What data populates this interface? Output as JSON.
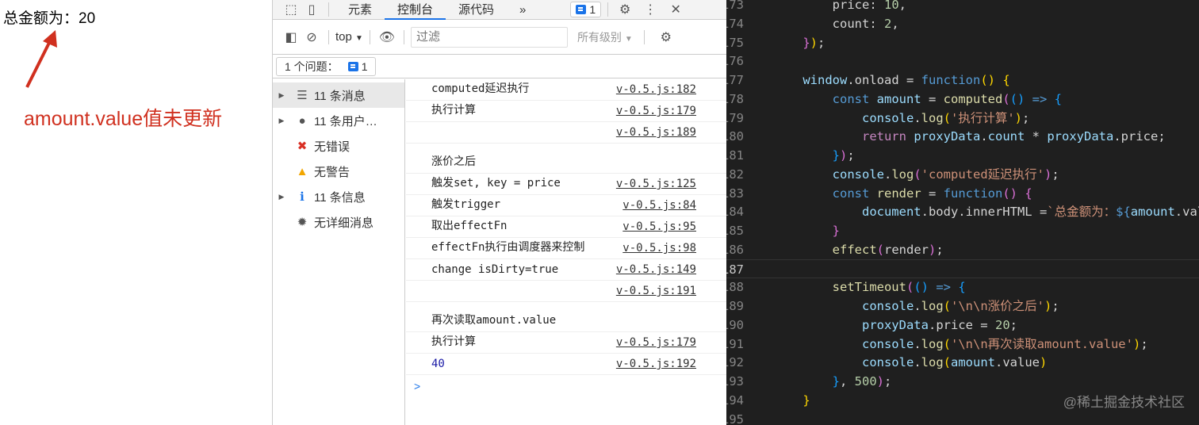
{
  "page": {
    "total_text": "总金额为：20",
    "annotation": "amount.value值未更新",
    "annotation_color": "#d0301f"
  },
  "devtools": {
    "tabs": [
      "元素",
      "控制台",
      "源代码"
    ],
    "active_tab": "控制台",
    "more": "»",
    "issues_badge": "1",
    "context": "top",
    "filter_placeholder": "过滤",
    "levels": "所有级别",
    "issues_label": "1 个问题：",
    "issues_count": "1",
    "sidebar": [
      {
        "label": "11 条消息",
        "icon": "list-icon",
        "expand": true
      },
      {
        "label": "11 条用户…",
        "icon": "user-icon",
        "expand": true
      },
      {
        "label": "无错误",
        "icon": "error-icon",
        "expand": false
      },
      {
        "label": "无警告",
        "icon": "warning-icon",
        "expand": false
      },
      {
        "label": "11 条信息",
        "icon": "info-icon",
        "expand": true
      },
      {
        "label": "无详细消息",
        "icon": "verbose-icon",
        "expand": false
      }
    ],
    "log": [
      {
        "text": "computed延迟执行",
        "src": "v-0.5.js:182"
      },
      {
        "text": "执行计算",
        "src": "v-0.5.js:179"
      },
      {
        "text": "",
        "src": "v-0.5.js:189"
      },
      {
        "text": "涨价之后",
        "src": ""
      },
      {
        "text": "触发set, key = price",
        "src": "v-0.5.js:125"
      },
      {
        "text": "触发trigger",
        "src": "v-0.5.js:84"
      },
      {
        "text": "取出effectFn",
        "src": "v-0.5.js:95"
      },
      {
        "text": "effectFn执行由调度器来控制",
        "src": "v-0.5.js:98"
      },
      {
        "text": "change isDirty=true",
        "src": "v-0.5.js:149"
      },
      {
        "text": "",
        "src": "v-0.5.js:191"
      },
      {
        "text": "再次读取amount.value",
        "src": ""
      },
      {
        "text": "执行计算",
        "src": "v-0.5.js:179"
      },
      {
        "text": "40",
        "src": "v-0.5.js:192",
        "number": true
      }
    ],
    "prompt": ">"
  },
  "editor": {
    "current_line": 187,
    "watermark": "@稀土掘金技术社区",
    "lines": [
      {
        "n": 173,
        "t": [
          [
            "        ",
            "p"
          ],
          [
            "price",
            "p"
          ],
          [
            ": ",
            "p"
          ],
          [
            "10",
            "n"
          ],
          [
            ",",
            "p"
          ]
        ]
      },
      {
        "n": 174,
        "t": [
          [
            "        ",
            "p"
          ],
          [
            "count",
            "p"
          ],
          [
            ": ",
            "p"
          ],
          [
            "2",
            "n"
          ],
          [
            ",",
            "p"
          ]
        ]
      },
      {
        "n": 175,
        "t": [
          [
            "    ",
            "p"
          ],
          [
            "}",
            "b2"
          ],
          [
            ")",
            "b1"
          ],
          [
            ";",
            "p"
          ]
        ]
      },
      {
        "n": 176,
        "t": []
      },
      {
        "n": 177,
        "t": [
          [
            "    ",
            "p"
          ],
          [
            "window",
            "v"
          ],
          [
            ".onload = ",
            "p"
          ],
          [
            "function",
            "k"
          ],
          [
            "()",
            "b1"
          ],
          [
            " ",
            "p"
          ],
          [
            "{",
            "b1"
          ]
        ]
      },
      {
        "n": 178,
        "t": [
          [
            "        ",
            "p"
          ],
          [
            "const ",
            "k"
          ],
          [
            "amount",
            "v"
          ],
          [
            " = ",
            "p"
          ],
          [
            "computed",
            "f"
          ],
          [
            "(",
            "b2"
          ],
          [
            "()",
            "b3"
          ],
          [
            " => ",
            "k"
          ],
          [
            "{",
            "b3"
          ]
        ]
      },
      {
        "n": 179,
        "t": [
          [
            "            ",
            "p"
          ],
          [
            "console",
            "v"
          ],
          [
            ".",
            "p"
          ],
          [
            "log",
            "f"
          ],
          [
            "(",
            "b1"
          ],
          [
            "'执行计算'",
            "s"
          ],
          [
            ")",
            "b1"
          ],
          [
            ";",
            "p"
          ]
        ]
      },
      {
        "n": 180,
        "t": [
          [
            "            ",
            "p"
          ],
          [
            "return ",
            "r"
          ],
          [
            "proxyData",
            "v"
          ],
          [
            ".",
            "p"
          ],
          [
            "count",
            "v"
          ],
          [
            " * ",
            "p"
          ],
          [
            "proxyData",
            "v"
          ],
          [
            ".price;",
            "p"
          ]
        ]
      },
      {
        "n": 181,
        "t": [
          [
            "        ",
            "p"
          ],
          [
            "}",
            "b3"
          ],
          [
            ")",
            "b2"
          ],
          [
            ";",
            "p"
          ]
        ]
      },
      {
        "n": 182,
        "t": [
          [
            "        ",
            "p"
          ],
          [
            "console",
            "v"
          ],
          [
            ".",
            "p"
          ],
          [
            "log",
            "f"
          ],
          [
            "(",
            "b2"
          ],
          [
            "'computed延迟执行'",
            "s"
          ],
          [
            ")",
            "b2"
          ],
          [
            ";",
            "p"
          ]
        ]
      },
      {
        "n": 183,
        "t": [
          [
            "        ",
            "p"
          ],
          [
            "const ",
            "k"
          ],
          [
            "render",
            "f"
          ],
          [
            " = ",
            "p"
          ],
          [
            "function",
            "k"
          ],
          [
            "()",
            "b2"
          ],
          [
            " ",
            "p"
          ],
          [
            "{",
            "b2"
          ]
        ]
      },
      {
        "n": 184,
        "t": [
          [
            "            ",
            "p"
          ],
          [
            "document",
            "v"
          ],
          [
            ".body.innerHTML =",
            "p"
          ],
          [
            "`总金额为：",
            "s"
          ],
          [
            "${",
            "k"
          ],
          [
            "amount",
            "v"
          ],
          [
            ".value}`",
            "p"
          ]
        ]
      },
      {
        "n": 185,
        "t": [
          [
            "        ",
            "p"
          ],
          [
            "}",
            "b2"
          ]
        ]
      },
      {
        "n": 186,
        "t": [
          [
            "        ",
            "p"
          ],
          [
            "effect",
            "f"
          ],
          [
            "(",
            "b2"
          ],
          [
            "render",
            "p"
          ],
          [
            ")",
            "b2"
          ],
          [
            ";",
            "p"
          ]
        ]
      },
      {
        "n": 187,
        "t": []
      },
      {
        "n": 188,
        "t": [
          [
            "        ",
            "p"
          ],
          [
            "setTimeout",
            "f"
          ],
          [
            "(",
            "b2"
          ],
          [
            "()",
            "b3"
          ],
          [
            " => ",
            "k"
          ],
          [
            "{",
            "b3"
          ]
        ]
      },
      {
        "n": 189,
        "t": [
          [
            "            ",
            "p"
          ],
          [
            "console",
            "v"
          ],
          [
            ".",
            "p"
          ],
          [
            "log",
            "f"
          ],
          [
            "(",
            "b1"
          ],
          [
            "'\\n\\n涨价之后'",
            "s"
          ],
          [
            ")",
            "b1"
          ],
          [
            ";",
            "p"
          ]
        ]
      },
      {
        "n": 190,
        "t": [
          [
            "            ",
            "p"
          ],
          [
            "proxyData",
            "v"
          ],
          [
            ".price = ",
            "p"
          ],
          [
            "20",
            "n"
          ],
          [
            ";",
            "p"
          ]
        ]
      },
      {
        "n": 191,
        "t": [
          [
            "            ",
            "p"
          ],
          [
            "console",
            "v"
          ],
          [
            ".",
            "p"
          ],
          [
            "log",
            "f"
          ],
          [
            "(",
            "b1"
          ],
          [
            "'\\n\\n再次读取amount.value'",
            "s"
          ],
          [
            ")",
            "b1"
          ],
          [
            ";",
            "p"
          ]
        ]
      },
      {
        "n": 192,
        "t": [
          [
            "            ",
            "p"
          ],
          [
            "console",
            "v"
          ],
          [
            ".",
            "p"
          ],
          [
            "log",
            "f"
          ],
          [
            "(",
            "b1"
          ],
          [
            "amount",
            "v"
          ],
          [
            ".value",
            "p"
          ],
          [
            ")",
            "b1"
          ]
        ]
      },
      {
        "n": 193,
        "t": [
          [
            "        ",
            "p"
          ],
          [
            "}",
            "b3"
          ],
          [
            ", ",
            "p"
          ],
          [
            "500",
            "n"
          ],
          [
            ")",
            "b2"
          ],
          [
            ";",
            "p"
          ]
        ]
      },
      {
        "n": 194,
        "t": [
          [
            "    ",
            "p"
          ],
          [
            "}",
            "b1"
          ]
        ]
      },
      {
        "n": 195,
        "t": []
      }
    ]
  }
}
